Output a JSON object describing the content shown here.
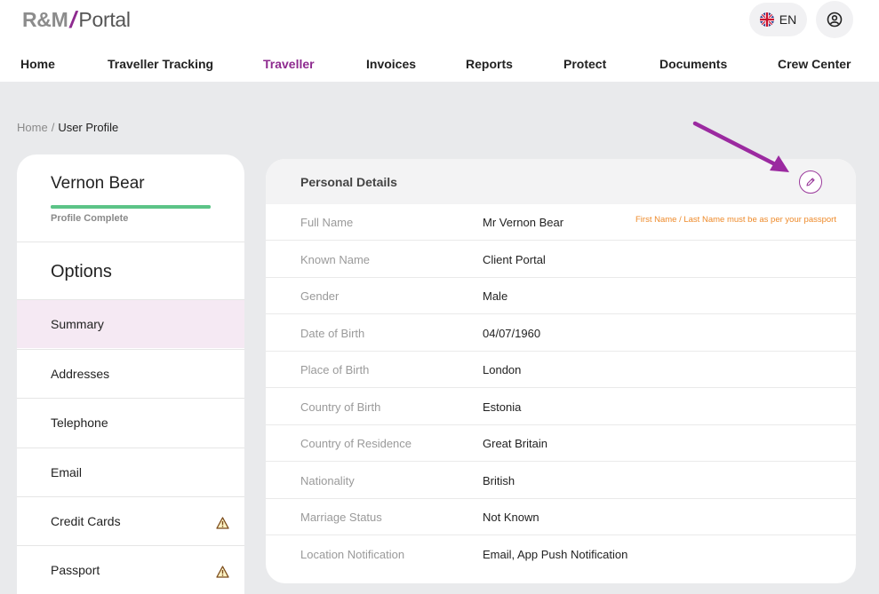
{
  "app": {
    "logo": {
      "brand": "R&M",
      "slash": "/",
      "product": "Portal"
    },
    "language": {
      "label": "EN",
      "flag_icon": "uk-flag-icon"
    },
    "user_icon": "user-circle-icon"
  },
  "nav": {
    "items": [
      {
        "label": "Home",
        "active": false
      },
      {
        "label": "Traveller Tracking",
        "active": false
      },
      {
        "label": "Traveller",
        "active": true
      },
      {
        "label": "Invoices",
        "active": false
      },
      {
        "label": "Reports",
        "active": false
      },
      {
        "label": "Protect",
        "active": false
      },
      {
        "label": "Documents",
        "active": false
      },
      {
        "label": "Crew Center",
        "active": false
      }
    ]
  },
  "breadcrumb": {
    "home": "Home",
    "separator": "/",
    "current": "User Profile"
  },
  "profile": {
    "name": "Vernon Bear",
    "status": "Profile Complete",
    "completion": 1.0
  },
  "sidebar": {
    "title": "Options",
    "items": [
      {
        "label": "Summary",
        "active": true,
        "warning": false
      },
      {
        "label": "Addresses",
        "active": false,
        "warning": false
      },
      {
        "label": "Telephone",
        "active": false,
        "warning": false
      },
      {
        "label": "Email",
        "active": false,
        "warning": false
      },
      {
        "label": "Credit Cards",
        "active": false,
        "warning": true
      },
      {
        "label": "Passport",
        "active": false,
        "warning": true
      }
    ]
  },
  "details": {
    "title": "Personal Details",
    "note": "First Name / Last Name must be as per your passport",
    "rows": [
      {
        "label": "Full Name",
        "value": "Mr Vernon Bear"
      },
      {
        "label": "Known Name",
        "value": "Client Portal"
      },
      {
        "label": "Gender",
        "value": "Male"
      },
      {
        "label": "Date of Birth",
        "value": "04/07/1960"
      },
      {
        "label": "Place of Birth",
        "value": "London"
      },
      {
        "label": "Country of Birth",
        "value": "Estonia"
      },
      {
        "label": "Country of Residence",
        "value": "Great Britain"
      },
      {
        "label": "Nationality",
        "value": "British"
      },
      {
        "label": "Marriage Status",
        "value": "Not Known"
      },
      {
        "label": "Location Notification",
        "value": "Email, App Push Notification"
      }
    ]
  },
  "colors": {
    "accent": "#8e2a8f",
    "progress": "#5cc487",
    "note": "#ee8a2a",
    "active_row": "#f5e9f3",
    "page_bg": "#e9eaec"
  }
}
